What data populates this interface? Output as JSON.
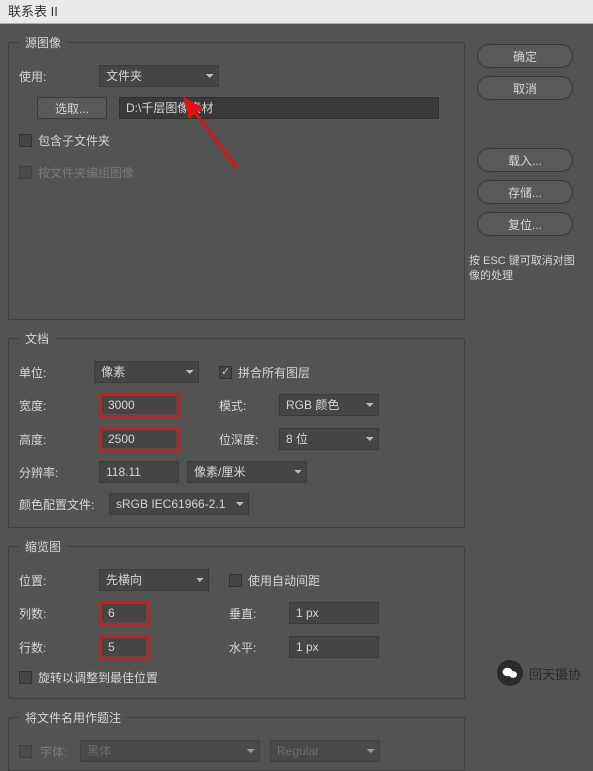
{
  "window": {
    "title": "联系表 II"
  },
  "side": {
    "ok": "确定",
    "cancel": "取消",
    "load": "载入...",
    "save": "存储...",
    "reset": "复位...",
    "hint": "按 ESC 键可取消对图像的处理"
  },
  "source": {
    "legend": "源图像",
    "use_label": "使用:",
    "use_value": "文件夹",
    "choose_btn": "选取...",
    "path": "D:\\千层图像素材",
    "include_sub": "包含子文件夹",
    "group_by_folder": "按文件夹编组图像"
  },
  "doc": {
    "legend": "文档",
    "unit_label": "单位:",
    "unit_value": "像素",
    "flatten_label": "拼合所有图层",
    "width_label": "宽度:",
    "width_value": "3000",
    "mode_label": "模式:",
    "mode_value": "RGB 颜色",
    "height_label": "高度:",
    "height_value": "2500",
    "depth_label": "位深度:",
    "depth_value": "8 位",
    "res_label": "分辨率:",
    "res_value": "118.11",
    "res_unit": "像素/厘米",
    "profile_label": "颜色配置文件:",
    "profile_value": "sRGB IEC61966-2.1"
  },
  "thumb": {
    "legend": "缩览图",
    "place_label": "位置:",
    "place_value": "先横向",
    "auto_gap_label": "使用自动间距",
    "cols_label": "列数:",
    "cols_value": "6",
    "vert_label": "垂直:",
    "vert_value": "1 px",
    "rows_label": "行数:",
    "rows_value": "5",
    "horiz_label": "水平:",
    "horiz_value": "1 px",
    "rotate_label": "旋转以调整到最佳位置"
  },
  "caption": {
    "legend": "将文件名用作题注",
    "font_label": "字体:",
    "font_value": "黑体",
    "style_value": "Regular"
  },
  "brand": {
    "name": "回天摄协"
  }
}
